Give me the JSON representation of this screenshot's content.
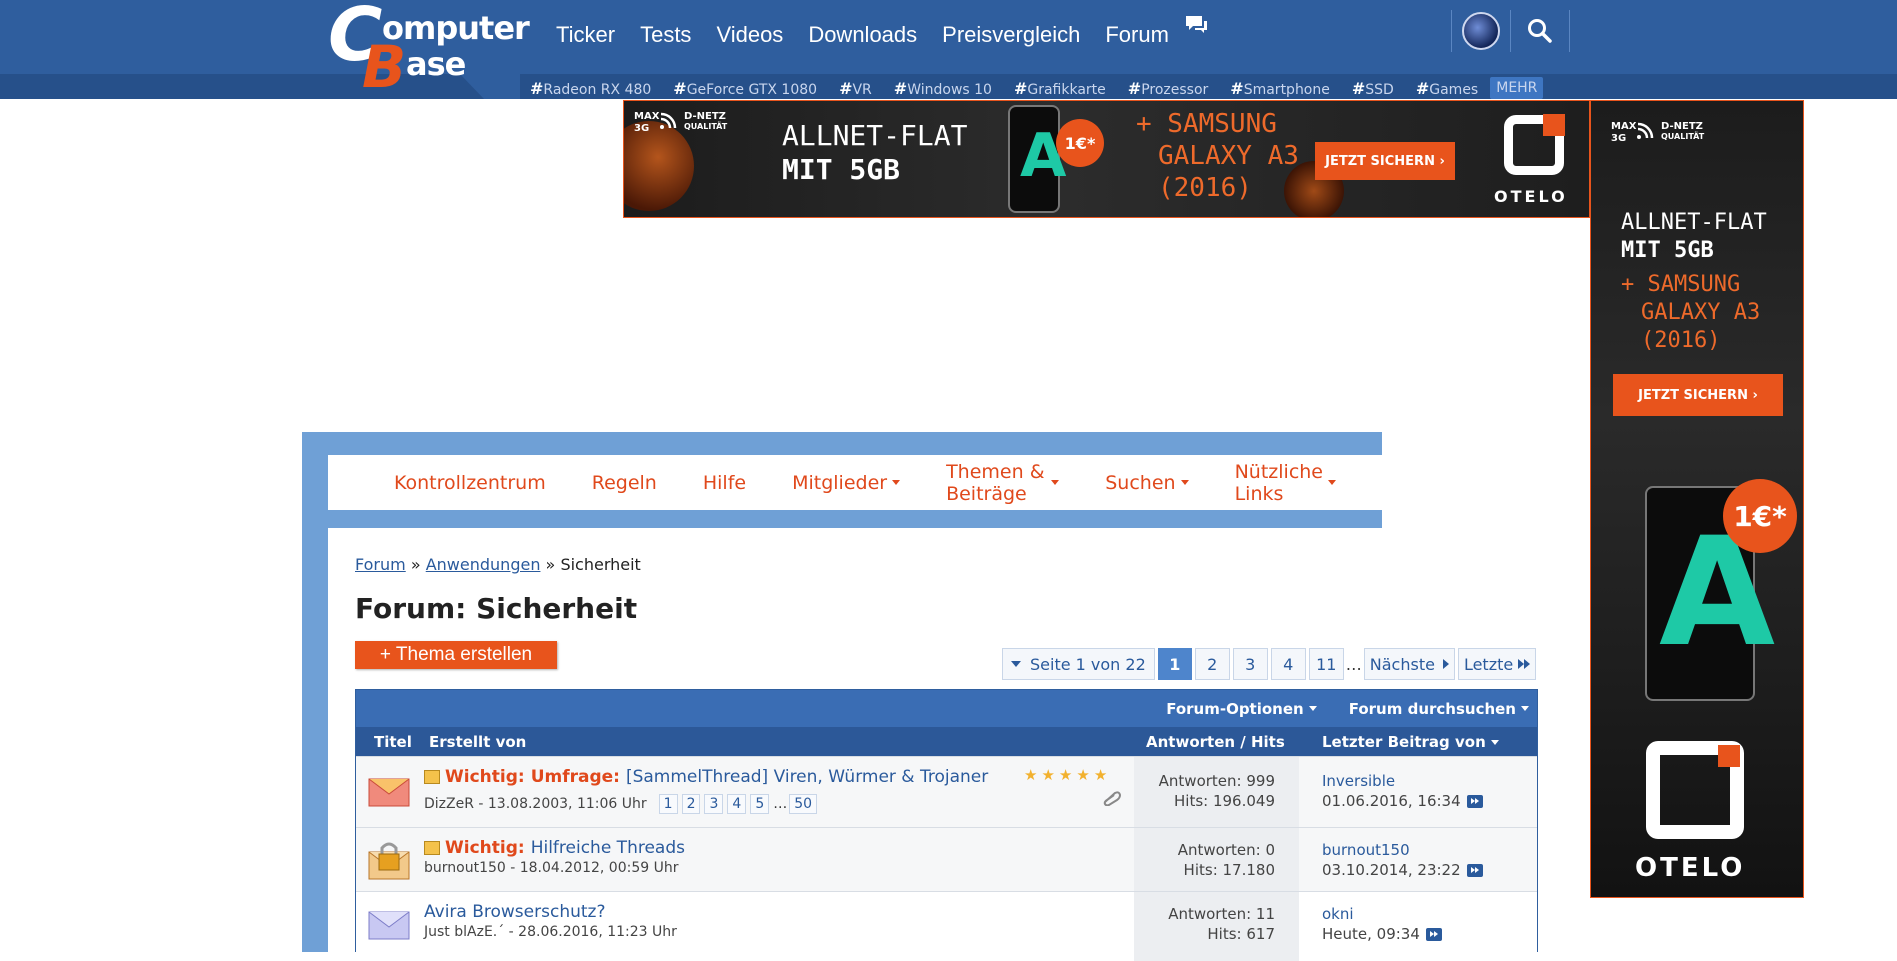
{
  "header": {
    "logo": {
      "line1": "omputer",
      "line2": "ase",
      "c": "C",
      "b": "B"
    },
    "nav": [
      "Ticker",
      "Tests",
      "Videos",
      "Downloads",
      "Preisvergleich",
      "Forum"
    ],
    "tags": [
      "Radeon RX 480",
      "GeForce GTX 1080",
      "VR",
      "Windows 10",
      "Grafikkarte",
      "Prozessor",
      "Smartphone",
      "SSD",
      "Games"
    ],
    "hash": "#",
    "more": "MEHR",
    "icons": {
      "globe": "globe-icon",
      "search": "search-icon",
      "forum": "chat-bubble-icon"
    }
  },
  "ads": {
    "banner": {
      "badge_top": "MAX",
      "badge_3g": "3G",
      "badge_net": "D-NETZ",
      "badge_q": "QUALITÄT",
      "line1": "ALLNET-FLAT",
      "line2": "MIT 5GB",
      "promo1": "+ SAMSUNG",
      "promo2": "GALAXY A3",
      "promo3": "(2016)",
      "price": "1€*",
      "cta": "JETZT SICHERN ›",
      "brand": "OTELO"
    },
    "sky": {
      "badge_top": "MAX",
      "badge_3g": "3G",
      "badge_net": "D-NETZ",
      "badge_q": "QUALITÄT",
      "line1": "ALLNET-FLAT",
      "line2": "MIT 5GB",
      "promo1": "+ SAMSUNG",
      "promo2": "GALAXY A3",
      "promo3": "(2016)",
      "cta": "JETZT SICHERN ›",
      "price": "1€*",
      "brand": "OTELO"
    }
  },
  "subnav": {
    "items": [
      {
        "label": "Kontrollzentrum",
        "dropdown": false
      },
      {
        "label": "Regeln",
        "dropdown": false
      },
      {
        "label": "Hilfe",
        "dropdown": false
      },
      {
        "label": "Mitglieder",
        "dropdown": true
      },
      {
        "label": "Themen & Beiträge",
        "dropdown": true
      },
      {
        "label": "Suchen",
        "dropdown": true
      },
      {
        "label": "Nützliche Links",
        "dropdown": true
      }
    ]
  },
  "breadcrumb": {
    "root": "Forum",
    "sep": "»",
    "parent": "Anwendungen",
    "current": "Sicherheit"
  },
  "page_title": "Forum: Sicherheit",
  "new_thread_label": "+ Thema erstellen",
  "pagination": {
    "info": "Seite 1 von 22",
    "current": "1",
    "pages": [
      "2",
      "3",
      "4",
      "11"
    ],
    "ellipsis": "…",
    "next": "Nächste",
    "last": "Letzte"
  },
  "table": {
    "options_label": "Forum-Optionen",
    "search_label": "Forum durchsuchen",
    "col_title": "Titel",
    "col_author": "Erstellt von",
    "col_stats": "Antworten / Hits",
    "col_last": "Letzter Beitrag von",
    "threads": [
      {
        "sticky_label": "Wichtig:",
        "prefix": "Umfrage:",
        "title": "[SammelThread] Viren, Würmer & Trojaner",
        "meta": "DizZeR - 13.08.2003, 11:06 Uhr",
        "pages": [
          "1",
          "2",
          "3",
          "4",
          "5",
          "…",
          "50"
        ],
        "rating": 5,
        "replies": "Antworten: 999",
        "hits": "Hits: 196.049",
        "last_user": "Inversible",
        "last_date": "01.06.2016, 16:34"
      },
      {
        "sticky_label": "Wichtig:",
        "title": "Hilfreiche Threads",
        "meta": "burnout150 - 18.04.2012, 00:59 Uhr",
        "replies": "Antworten: 0",
        "hits": "Hits: 17.180",
        "last_user": "burnout150",
        "last_date": "03.10.2014, 23:22"
      },
      {
        "title": "Avira Browserschutz?",
        "meta": "Just blAzE.´ - 28.06.2016, 11:23 Uhr",
        "replies": "Antworten: 11",
        "hits": "Hits: 617",
        "last_user": "okni",
        "last_date": "Heute, 09:34"
      }
    ]
  }
}
